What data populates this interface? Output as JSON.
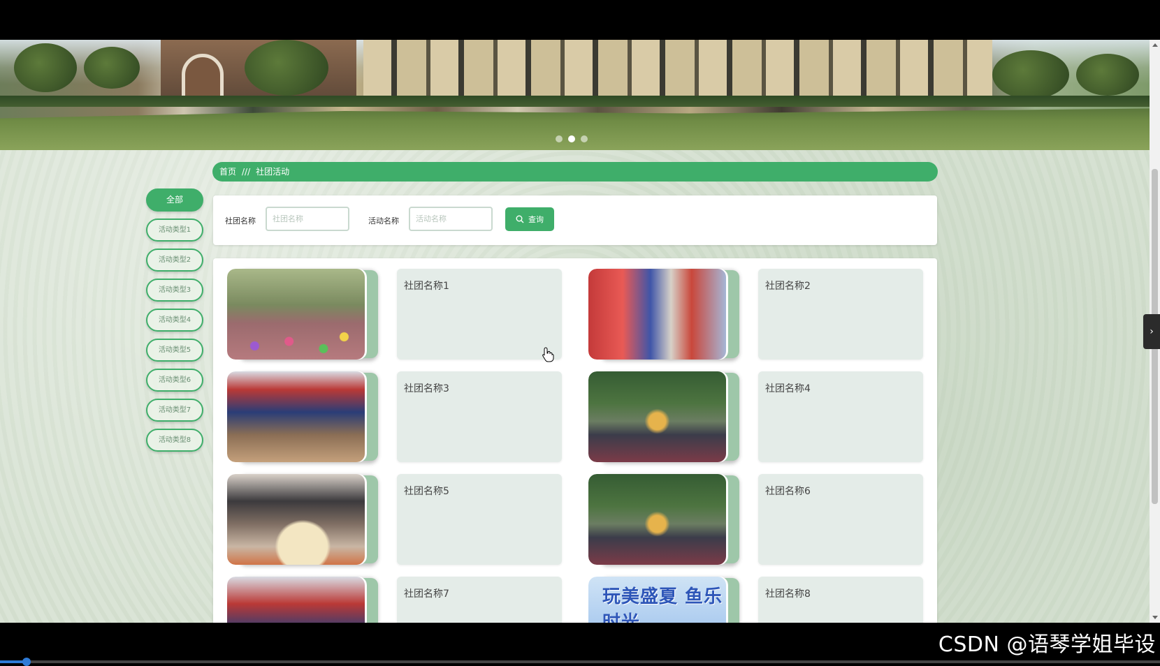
{
  "breadcrumb": {
    "home": "首页",
    "separator": "///",
    "current": "社团活动"
  },
  "categories": [
    {
      "label": "全部",
      "active": true
    },
    {
      "label": "活动类型1"
    },
    {
      "label": "活动类型2"
    },
    {
      "label": "活动类型3"
    },
    {
      "label": "活动类型4"
    },
    {
      "label": "活动类型5"
    },
    {
      "label": "活动类型6"
    },
    {
      "label": "活动类型7"
    },
    {
      "label": "活动类型8"
    }
  ],
  "search": {
    "club_label": "社团名称",
    "club_placeholder": "社团名称",
    "activity_label": "活动名称",
    "activity_placeholder": "活动名称",
    "button_label": "查询"
  },
  "cards": [
    {
      "name": "社团名称1"
    },
    {
      "name": "社团名称2"
    },
    {
      "name": "社团名称3"
    },
    {
      "name": "社团名称4"
    },
    {
      "name": "社团名称5"
    },
    {
      "name": "社团名称6"
    },
    {
      "name": "社团名称7"
    },
    {
      "name": "社团名称8",
      "image_text": "玩美盛夏 鱼乐时光"
    }
  ],
  "carousel": {
    "slides": 3,
    "active_index": 1
  },
  "watermark": "CSDN @语琴学姐毕设",
  "colors": {
    "accent": "#3fae6a",
    "background": "#d8e3d4",
    "card_info": "#e4ece8"
  }
}
